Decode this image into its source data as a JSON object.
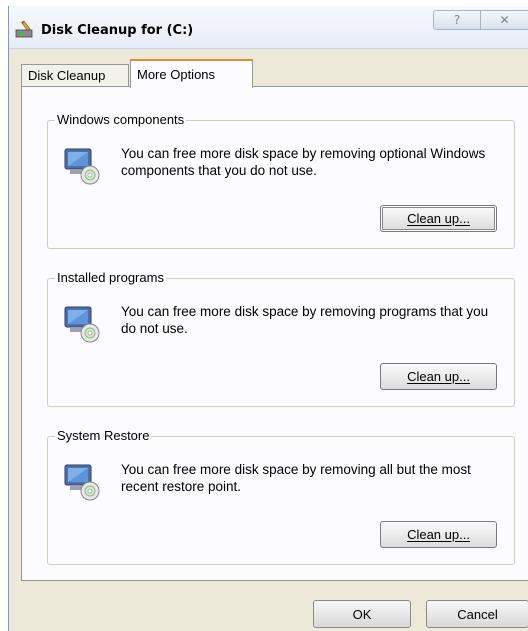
{
  "window": {
    "title": "Disk Cleanup for  (C:)",
    "help_glyph": "?",
    "close_glyph": "✕"
  },
  "tabs": [
    {
      "label": "Disk Cleanup",
      "active": false
    },
    {
      "label": "More Options",
      "active": true
    }
  ],
  "groups": [
    {
      "label": "Windows components",
      "description": "You can free more disk space by removing optional Windows components that you do not use.",
      "button_label": "Clean up..."
    },
    {
      "label": "Installed programs",
      "description": "You can free more disk space by removing programs that you do not use.",
      "button_label": "Clean up..."
    },
    {
      "label": "System Restore",
      "description": "You can free more disk space by removing all but the most recent restore point.",
      "button_label": "Clean up..."
    }
  ],
  "footer": {
    "ok_label": "OK",
    "cancel_label": "Cancel"
  },
  "colors": {
    "dialog_bg": "#ece9d8",
    "panel_bg": "#fcfcfe",
    "active_tab_accent": "#e68b2c"
  }
}
